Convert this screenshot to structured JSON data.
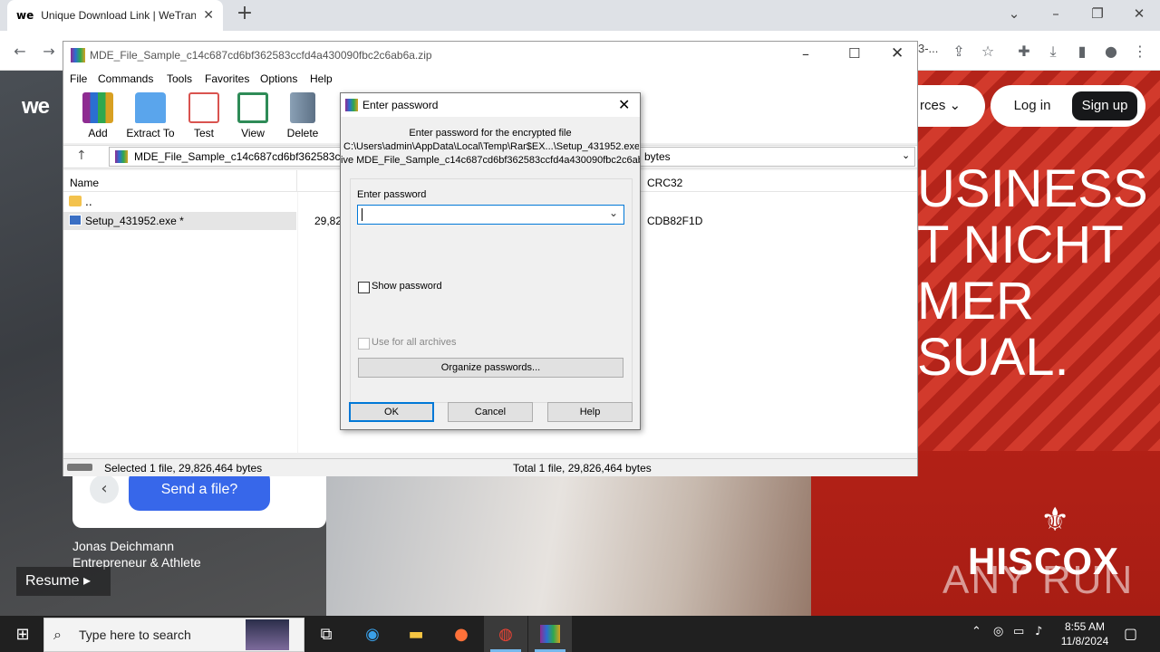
{
  "browser": {
    "tab_title": "Unique Download Link | WeTran",
    "tab_favicon": "we",
    "new_tab": "+",
    "close_tab": "✕"
  },
  "webpage": {
    "logo": "we",
    "nav_resources": "rces ⌄",
    "login": "Log in",
    "signup": "Sign up",
    "hero_lines": [
      "USINESS",
      "T NICHT",
      "MER",
      "SUAL."
    ],
    "send_file": "Send a file?",
    "person_name": "Jonas Deichmann",
    "person_title": "Entrepreneur & Athlete",
    "resume": "Resume",
    "brand": "HISCOX",
    "watermark": "ANY RUN",
    "url_fragment": "3-..."
  },
  "winrar": {
    "window_title": "MDE_File_Sample_c14c687cd6bf362583ccfd4a430090fbc2c6ab6a.zip",
    "menu": [
      "File",
      "Commands",
      "Tools",
      "Favorites",
      "Options",
      "Help"
    ],
    "tools": [
      {
        "label": "Add",
        "icon": "add-icon",
        "color": "#c0392b"
      },
      {
        "label": "Extract To",
        "icon": "extract-icon",
        "color": "#3a8ee6"
      },
      {
        "label": "Test",
        "icon": "test-icon",
        "color": "#d9534f"
      },
      {
        "label": "View",
        "icon": "view-icon",
        "color": "#2e8b57"
      },
      {
        "label": "Delete",
        "icon": "delete-icon",
        "color": "#7a8a99"
      }
    ],
    "address": "MDE_File_Sample_c14c687cd6bf362583ccfd",
    "address_tail": "bytes",
    "columns": {
      "name": "Name",
      "crc": "CRC32"
    },
    "files": [
      {
        "name": "..",
        "size": "",
        "crc": ""
      },
      {
        "name": "Setup_431952.exe *",
        "size": "29,82",
        "crc": "CDB82F1D"
      }
    ],
    "status_left": "Selected 1 file, 29,826,464 bytes",
    "status_right": "Total 1 file, 29,826,464 bytes"
  },
  "dialog": {
    "title": "Enter password",
    "message": "Enter password for the encrypted file",
    "path": "C:\\Users\\admin\\AppData\\Local\\Temp\\Rar$EX...\\Setup_431952.exe",
    "archive": "ive MDE_File_Sample_c14c687cd6bf362583ccfd4a430090fbc2c6ab",
    "field_label": "Enter password",
    "password_value": "",
    "show_password": "Show password",
    "use_for_all": "Use for all archives",
    "organize": "Organize passwords...",
    "ok": "OK",
    "cancel": "Cancel",
    "help": "Help"
  },
  "taskbar": {
    "search_placeholder": "Type here to search",
    "time": "8:55 AM",
    "date": "11/8/2024"
  }
}
